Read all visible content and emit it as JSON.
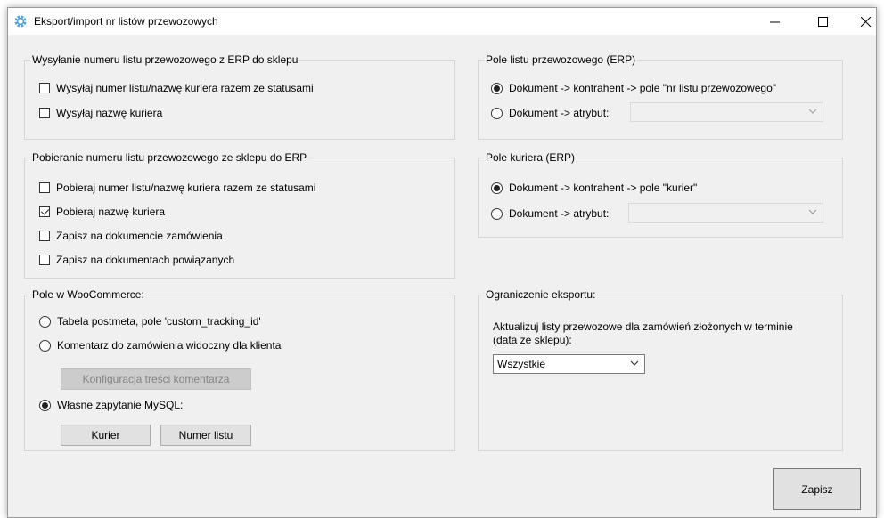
{
  "window": {
    "title": "Eksport/import nr listów przewozowych",
    "minimize_glyph": "—",
    "maximize_glyph": "☐",
    "close_glyph": "✕"
  },
  "send_group": {
    "legend": "Wysyłanie numeru listu przewozowego z ERP do sklepu",
    "items": [
      {
        "label": "Wysyłaj numer listu/nazwę kuriera razem ze statusami",
        "checked": false
      },
      {
        "label": "Wysyłaj nazwę kuriera",
        "checked": false
      }
    ]
  },
  "fetch_group": {
    "legend": "Pobieranie numeru listu przewozowego ze sklepu do ERP",
    "items": [
      {
        "label": "Pobieraj numer listu/nazwę kuriera razem ze statusami",
        "checked": false
      },
      {
        "label": "Pobieraj nazwę kuriera",
        "checked": true
      },
      {
        "label": "Zapisz na dokumencie zamówienia",
        "checked": false
      },
      {
        "label": "Zapisz na dokumentach powiązanych",
        "checked": false
      }
    ]
  },
  "woo_group": {
    "legend": "Pole w WooCommerce:",
    "options": [
      {
        "label": "Tabela postmeta, pole 'custom_tracking_id'",
        "checked": false
      },
      {
        "label": "Komentarz do zamówienia widoczny dla klienta",
        "checked": false
      },
      {
        "label": "Własne zapytanie MySQL:",
        "checked": true
      }
    ],
    "config_button": "Konfiguracja treści komentarza",
    "courier_button": "Kurier",
    "number_button": "Numer listu"
  },
  "waybill_field_group": {
    "legend": "Pole listu przewozowego (ERP)",
    "option_contractor": "Dokument -> kontrahent -> pole \"nr listu przewozowego\"",
    "option_attribute": "Dokument -> atrybut:",
    "attribute_value": ""
  },
  "courier_field_group": {
    "legend": "Pole kuriera (ERP)",
    "option_contractor": "Dokument -> kontrahent -> pole \"kurier\"",
    "option_attribute": "Dokument -> atrybut:",
    "attribute_value": ""
  },
  "limit_group": {
    "legend": "Ograniczenie eksportu:",
    "description_line1": "Aktualizuj listy przewozowe dla zamówień złożonych w terminie",
    "description_line2": "(data ze sklepu):",
    "selected": "Wszystkie"
  },
  "save_button": "Zapisz"
}
